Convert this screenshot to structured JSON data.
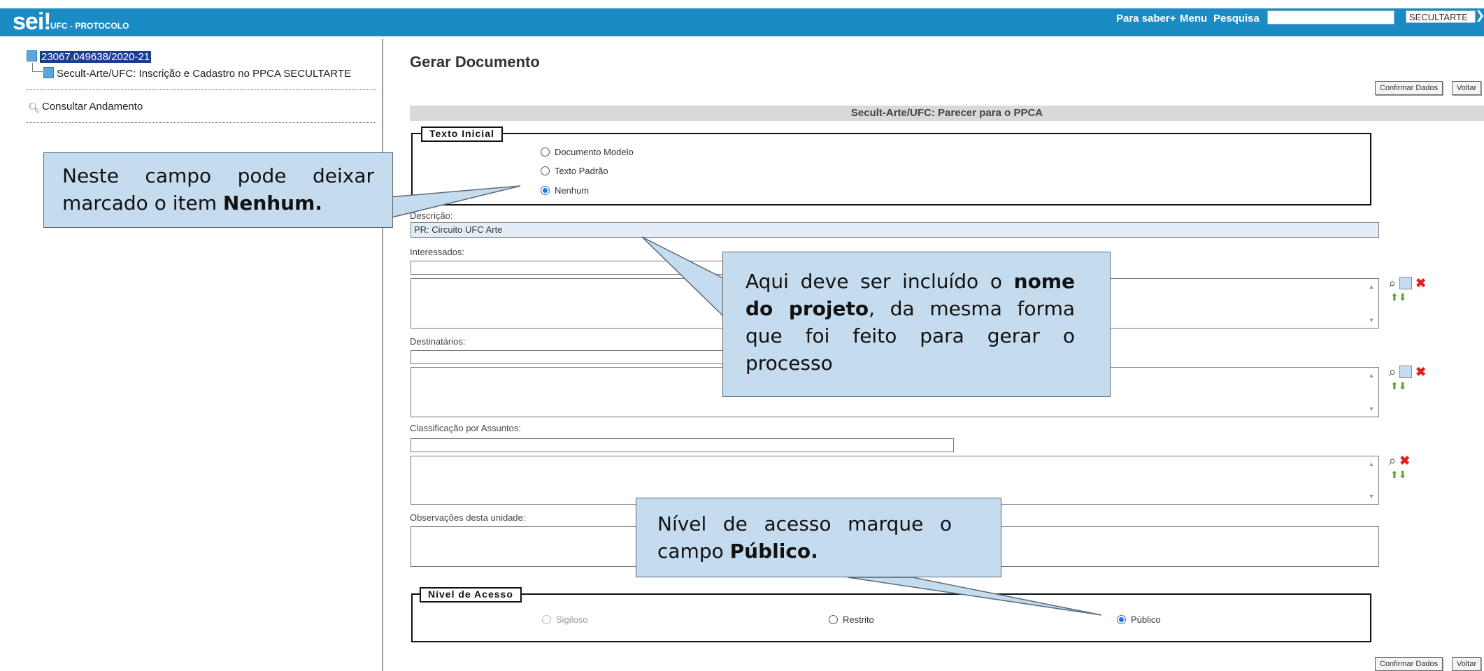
{
  "header": {
    "logo": "sei!",
    "unit": "UFC - PROTOCOLO",
    "nav": [
      "Para saber+",
      "Menu",
      "Pesquisa"
    ],
    "unit_select": "SECULTARTE"
  },
  "tree": {
    "process_number": "23067.049638/2020-21",
    "document": "Secult-Arte/UFC: Inscrição e Cadastro no PPCA SECULTARTE",
    "consult": "Consultar Andamento"
  },
  "main": {
    "title": "Gerar Documento",
    "confirm_button": "Confirmar Dados",
    "back_button": "Voltar",
    "doc_type": "Secult-Arte/UFC: Parecer para o PPCA",
    "texto_inicial": {
      "legend": "Texto Inicial",
      "options": [
        "Documento Modelo",
        "Texto Padrão",
        "Nenhum"
      ],
      "selected": "Nenhum"
    },
    "descricao_label": "Descrição:",
    "descricao_value": "PR: Circuito UFC Arte",
    "interessados_label": "Interessados:",
    "destinatarios_label": "Destinatários:",
    "classificacao_label": "Classificação por Assuntos:",
    "observacoes_label": "Observações desta unidade:",
    "nivel_acesso": {
      "legend": "Nível de Acesso",
      "options": [
        "Sigiloso",
        "Restrito",
        "Público"
      ],
      "selected": "Público"
    }
  },
  "callouts": {
    "c1_text": "Neste campo pode deixar marcado o item ",
    "c1_bold": "Nenhum.",
    "c2_text1": "Aqui deve ser incluído o ",
    "c2_bold1": "nome do projeto",
    "c2_text2": ", da mesma forma que foi feito para gerar o processo",
    "c3_text": "Nível de acesso marque o campo ",
    "c3_bold": "Público."
  }
}
